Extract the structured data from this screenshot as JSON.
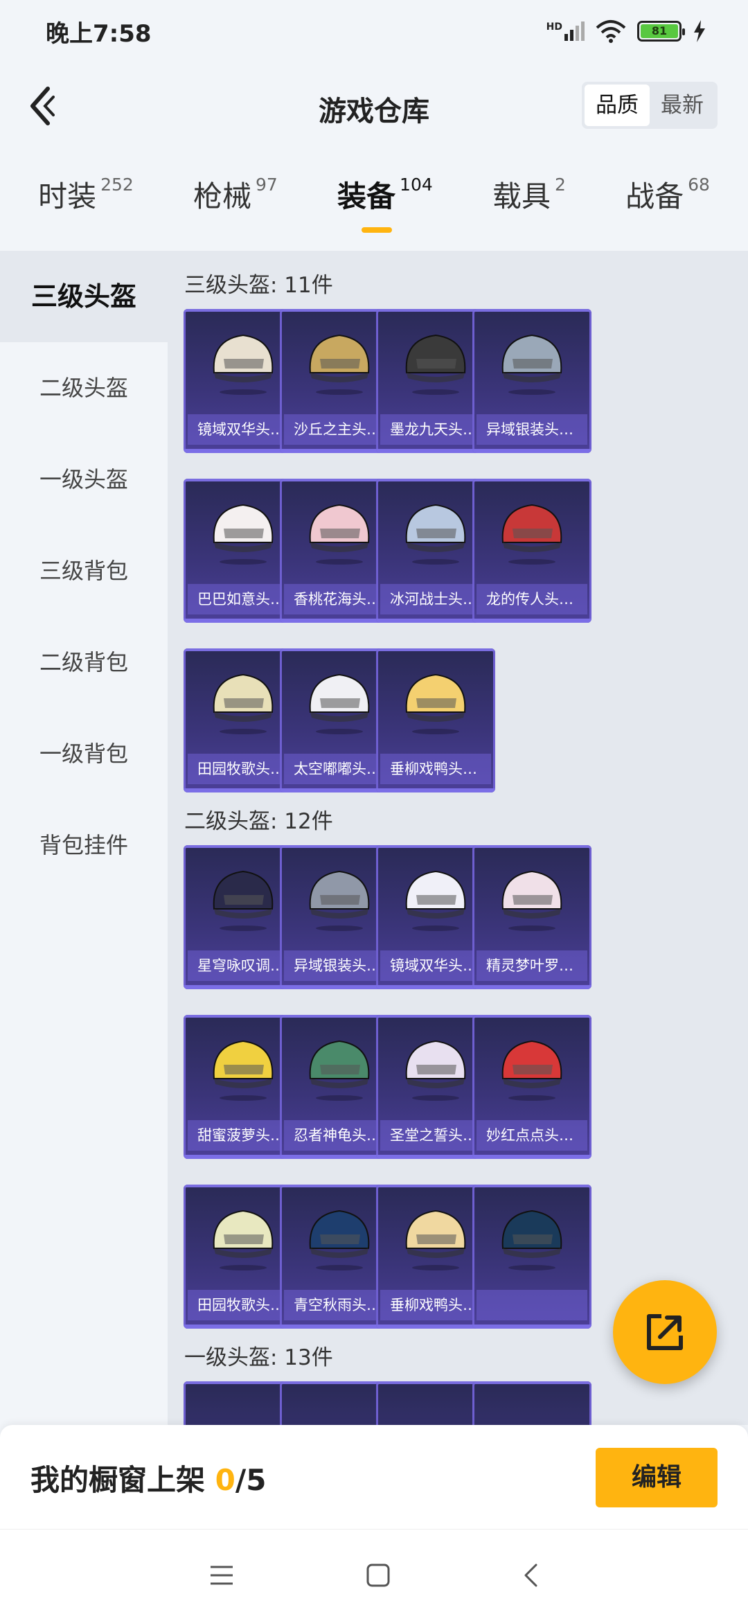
{
  "status_bar": {
    "time": "晚上7:58",
    "hd": "HD",
    "battery": "81"
  },
  "header": {
    "title": "游戏仓库",
    "sort_options": [
      "品质",
      "最新"
    ],
    "active_sort": "品质"
  },
  "tabs": [
    {
      "label": "时装",
      "count": "252"
    },
    {
      "label": "枪械",
      "count": "97"
    },
    {
      "label": "装备",
      "count": "104"
    },
    {
      "label": "载具",
      "count": "2"
    },
    {
      "label": "战备",
      "count": "68"
    }
  ],
  "active_tab": "装备",
  "sidebar": [
    "三级头盔",
    "二级头盔",
    "一级头盔",
    "三级背包",
    "二级背包",
    "一级背包",
    "背包挂件"
  ],
  "active_sidebar": "三级头盔",
  "sections": [
    {
      "title": "三级头盔: 11件",
      "items": [
        "镜域双华头…",
        "沙丘之主头…",
        "墨龙九天头…",
        "异域银装头…",
        "巴巴如意头…",
        "香桃花海头…",
        "冰河战士头…",
        "龙的传人头…",
        "田园牧歌头…",
        "太空嘟嘟头…",
        "垂柳戏鸭头…"
      ]
    },
    {
      "title": "二级头盔: 12件",
      "items": [
        "星穹咏叹调…",
        "异域银装头…",
        "镜域双华头…",
        "精灵梦叶罗…",
        "甜蜜菠萝头…",
        "忍者神龟头…",
        "圣堂之誓头…",
        "妙红点点头…",
        "田园牧歌头…",
        "青空秋雨头…",
        "垂柳戏鸭头…",
        ""
      ]
    },
    {
      "title": "一级头盔: 13件",
      "items": []
    }
  ],
  "helmet_colors": [
    "#e8e0d0",
    "#c8a860",
    "#3a3a3a",
    "#9aa8b8",
    "#f4f0f0",
    "#f0c8d0",
    "#b8c8e0",
    "#c83838",
    "#e8e0b8",
    "#f0f0f4",
    "#f4d070",
    "#2a2a4a",
    "#9098a8",
    "#f0f0f8",
    "#f0e0e8",
    "#f0d040",
    "#4a8a6a",
    "#e8e0f0",
    "#d83838",
    "#e8e8c0",
    "#1e3e6e",
    "#f0d8a0",
    "#1a3a5a"
  ],
  "bottom_bar": {
    "shelf_label": "我的橱窗上架 ",
    "shelf_current": "0",
    "shelf_total": "/5",
    "edit_label": "编辑"
  }
}
